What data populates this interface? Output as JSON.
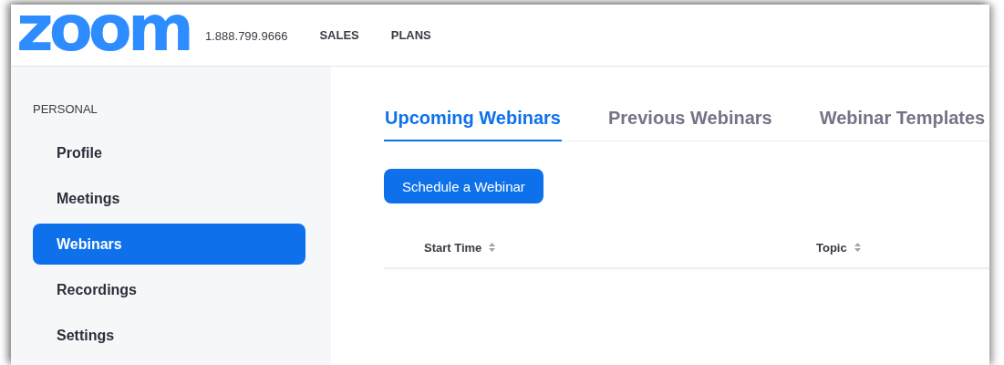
{
  "header": {
    "logo": "zoom",
    "phone": "1.888.799.9666",
    "nav": [
      "SALES",
      "PLANS"
    ]
  },
  "sidebar": {
    "section": "PERSONAL",
    "items": [
      {
        "label": "Profile",
        "selected": false
      },
      {
        "label": "Meetings",
        "selected": false
      },
      {
        "label": "Webinars",
        "selected": true
      },
      {
        "label": "Recordings",
        "selected": false
      },
      {
        "label": "Settings",
        "selected": false
      }
    ]
  },
  "tabs": [
    {
      "label": "Upcoming Webinars",
      "selected": true
    },
    {
      "label": "Previous Webinars",
      "selected": false
    },
    {
      "label": "Webinar Templates",
      "selected": false
    }
  ],
  "schedule_button": "Schedule a Webinar",
  "table": {
    "columns": [
      "Start Time",
      "Topic"
    ]
  }
}
